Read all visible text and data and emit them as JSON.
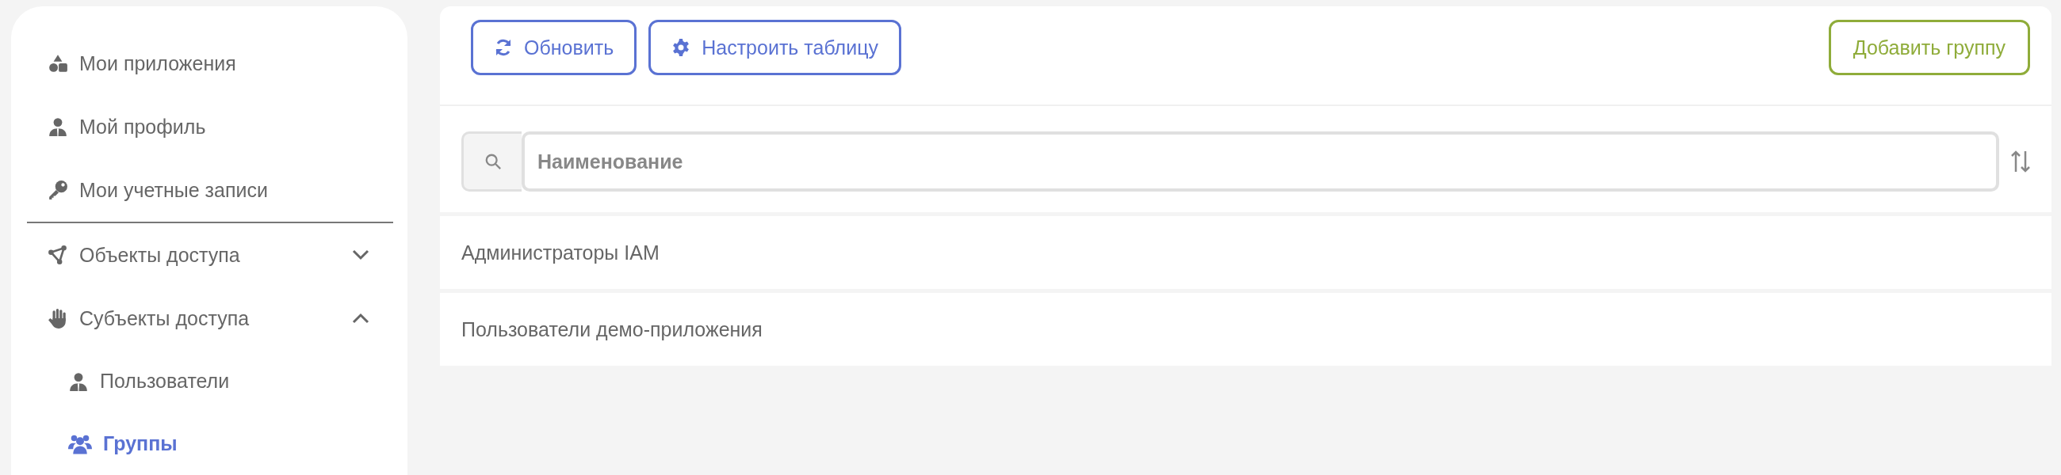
{
  "sidebar": {
    "groups": [
      {
        "items": [
          {
            "label": "Мои приложения",
            "selected": false
          },
          {
            "label": "Мой профиль",
            "selected": false
          },
          {
            "label": "Мои учетные записи",
            "selected": false
          }
        ]
      },
      {
        "items": [
          {
            "label": "Объекты доступа",
            "selected": false,
            "expanded": false
          },
          {
            "label": "Субъекты доступа",
            "selected": false,
            "expanded": true,
            "children": [
              {
                "label": "Пользователи",
                "selected": false
              },
              {
                "label": "Группы",
                "selected": true
              }
            ]
          }
        ]
      }
    ]
  },
  "toolbar": {
    "buttons": [
      {
        "label": "Обновить"
      },
      {
        "label": "Настроить таблицу"
      }
    ],
    "add_button": {
      "label": "Добавить группу"
    }
  },
  "table": {
    "search": {
      "placeholder": "Наименование"
    },
    "rows": [
      "Администраторы IAM",
      "Пользователи демо-приложения"
    ]
  }
}
